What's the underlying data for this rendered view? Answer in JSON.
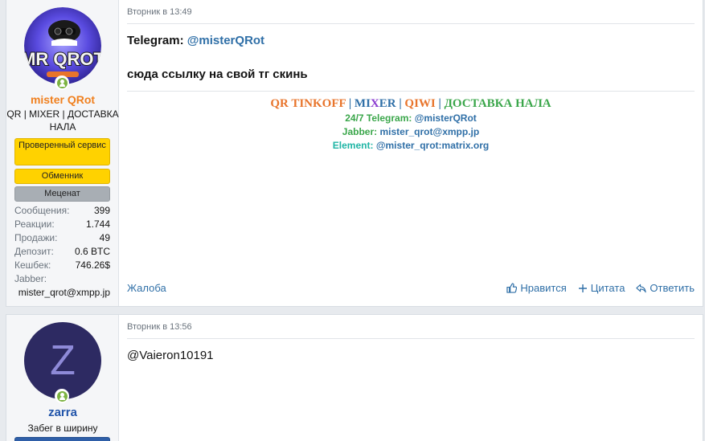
{
  "posts": [
    {
      "user": {
        "name": "mister QRot",
        "title": "QR | MIXER | ДОСТАВКА НАЛА",
        "avatar_text": "MR QROT",
        "banners": [
          "Проверенный сервис",
          "Обменник",
          "Меценат"
        ],
        "stats": [
          {
            "label": "Сообщения:",
            "value": "399"
          },
          {
            "label": "Реакции:",
            "value": "1.744"
          },
          {
            "label": "Продажи:",
            "value": "49"
          },
          {
            "label": "Депозит:",
            "value": "0.6 BTC"
          },
          {
            "label": "Кешбек:",
            "value": "746.26$"
          }
        ],
        "jabber_label": "Jabber:",
        "jabber_value": "mister_qrot@xmpp.jp"
      },
      "timestamp": "Вторник в 13:49",
      "body": {
        "telegram_label": "Telegram:",
        "telegram_handle": "@misterQRot",
        "text": "сюда ссылку на свой тг скинь"
      },
      "signature": {
        "line1": {
          "qr_tinkoff": "QR TINKOFF",
          "sep": "|",
          "mixer": [
            "MI",
            "X",
            "ER"
          ],
          "qiwi": "QIWI",
          "delivery": "ДОСТАВКА НАЛА"
        },
        "telegram_label": "24/7 Telegram:",
        "telegram_value": "@misterQRot",
        "jabber_label": "Jabber:",
        "jabber_value": "mister_qrot@xmpp.jp",
        "element_label": "Element:",
        "element_value": "@mister_qrot:matrix.org"
      },
      "actions": {
        "report": "Жалоба",
        "like": "Нравится",
        "quote": "Цитата",
        "reply": "Ответить"
      }
    },
    {
      "user": {
        "name": "zarra",
        "avatar_letter": "Z",
        "title": "Забег в ширину"
      },
      "timestamp": "Вторник в 13:56",
      "body": {
        "text": "@Vaieron10191"
      }
    }
  ],
  "colors": {
    "link": "#2f6fa7",
    "username_orange": "#f0801f",
    "username_blue": "#2255aa",
    "banner_yellow": "#ffd200",
    "banner_grey": "#a8aeb4",
    "sig_orange": "#e8742b",
    "sig_green": "#3aa64a",
    "sig_teal": "#1fb5a5",
    "sig_blue": "#2f6fa7",
    "sig_purple": "#8a3bd0",
    "online": "#7cb342",
    "avatar_z_bg": "#2d2a62",
    "avatar_z_letter": "#8e8ad8"
  }
}
